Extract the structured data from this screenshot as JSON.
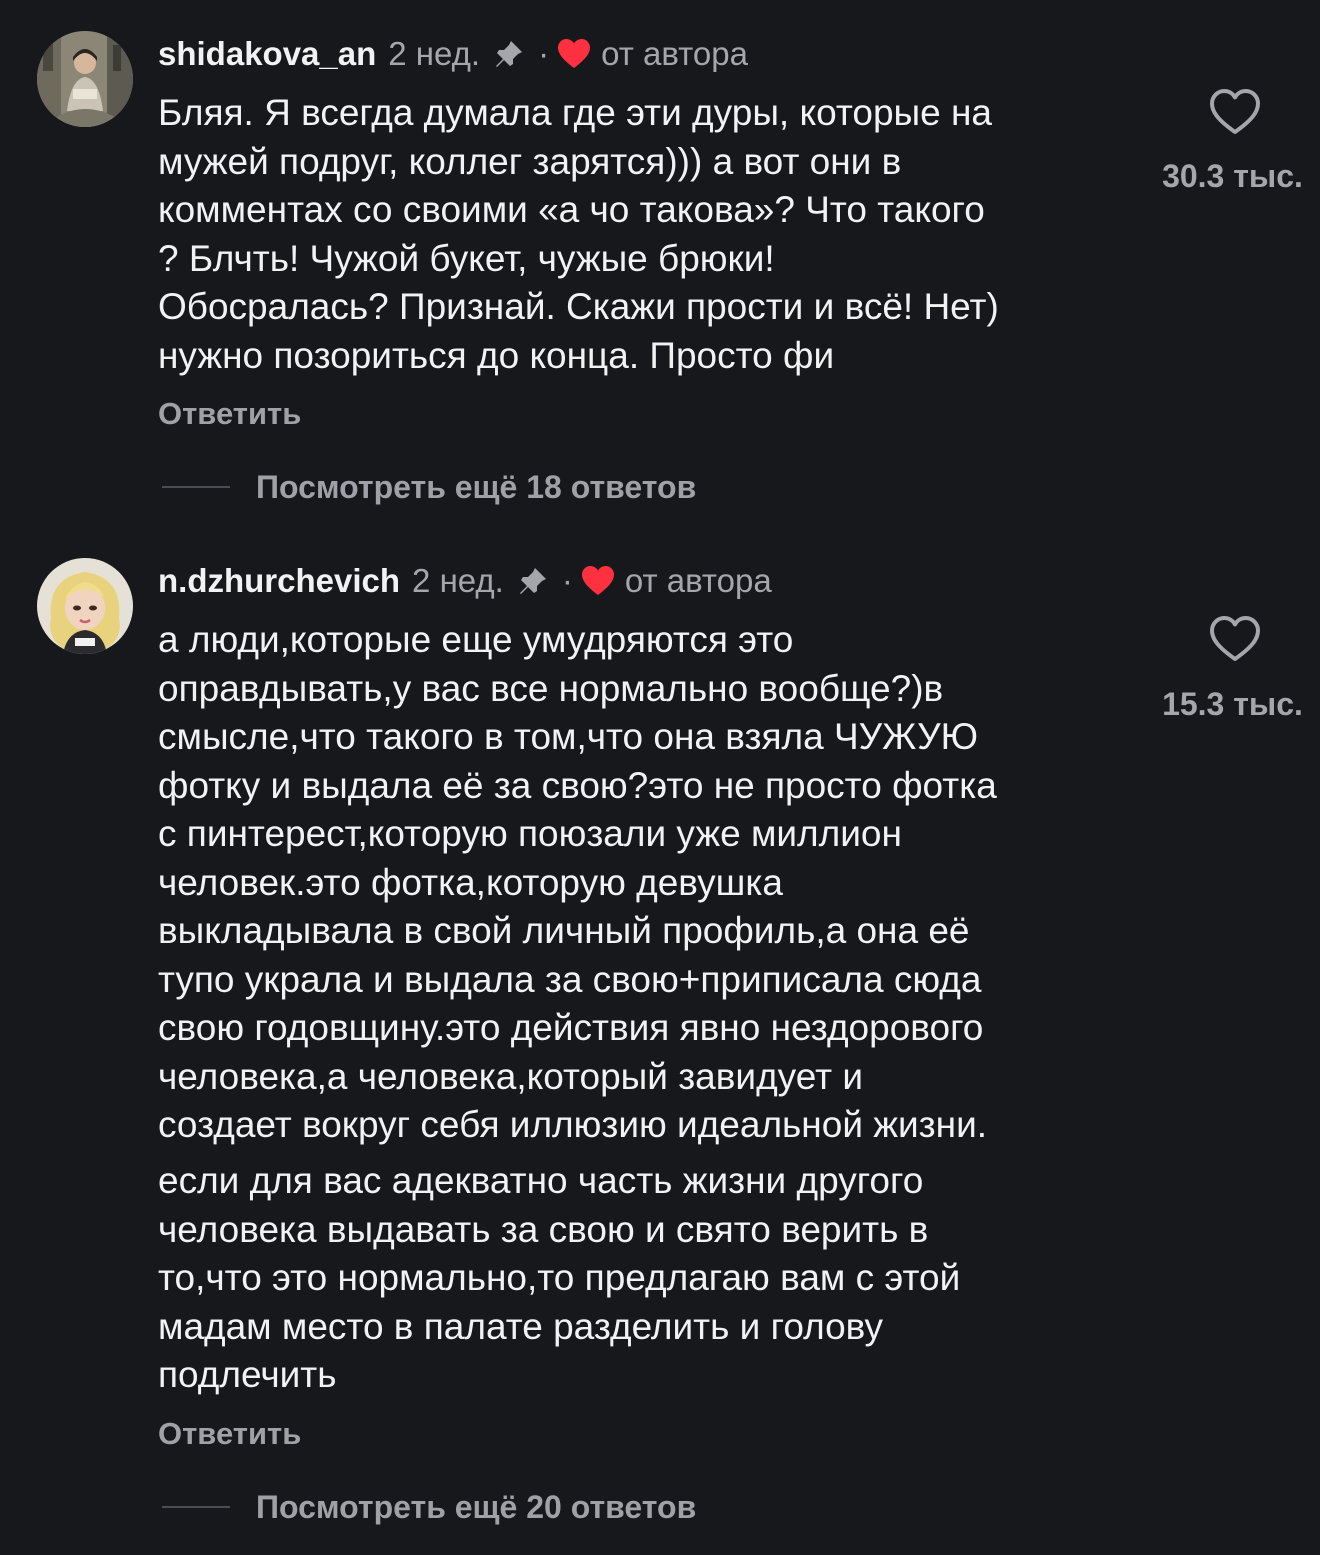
{
  "comments": [
    {
      "username": "shidakova_an",
      "time": "2 нед.",
      "separator": "·",
      "author_badge": "от автора",
      "lines": [
        "Бляя. Я всегда думала где эти дуры, которые на",
        "мужей подруг, коллег зарятся))) а вот они в",
        "комментах со своими «а чо такова»? Что такого",
        "? Блчть! Чужой букет, чужые брюки!",
        "Обосралась? Признай. Скажи прости и всё! Нет)",
        "нужно позориться до конца. Просто фи"
      ],
      "reply_label": "Ответить",
      "view_replies_label": "Посмотреть ещё 18 ответов",
      "like_count": "30.3 тыс.",
      "avatar_icon": "avatar-woman-reading-icon",
      "heart_color": "#ff3040"
    },
    {
      "username": "n.dzhurchevich",
      "time": "2 нед.",
      "separator": "·",
      "author_badge": "от автора",
      "paragraph1": [
        "а люди,которые еще умудряются это",
        "оправдывать,у вас все нормально вообще?)в",
        "смысле,что такого в том,что она взяла ЧУЖУЮ",
        "фотку и выдала её за свою?это не просто фотка",
        "с пинтерест,которую поюзали уже миллион",
        "человек.это фотка,которую девушка",
        "выкладывала в свой личный профиль,а она её",
        "тупо украла и выдала за свою+приписала сюда",
        "свою годовщину.это действия явно нездорового",
        "человека,а человека,который завидует и",
        "создает вокруг себя иллюзию идеальной жизни."
      ],
      "paragraph2": [
        "если для вас адекватно часть жизни другого",
        "человека выдавать за свою и свято верить в",
        "то,что это нормально,то предлагаю вам с этой",
        "мадам место в палате разделить и голову",
        "подлечить"
      ],
      "reply_label": "Ответить",
      "view_replies_label": "Посмотреть ещё 20 ответов",
      "like_count": "15.3 тыс.",
      "avatar_icon": "avatar-blonde-cartoon-icon",
      "heart_color": "#ff3040"
    }
  ]
}
